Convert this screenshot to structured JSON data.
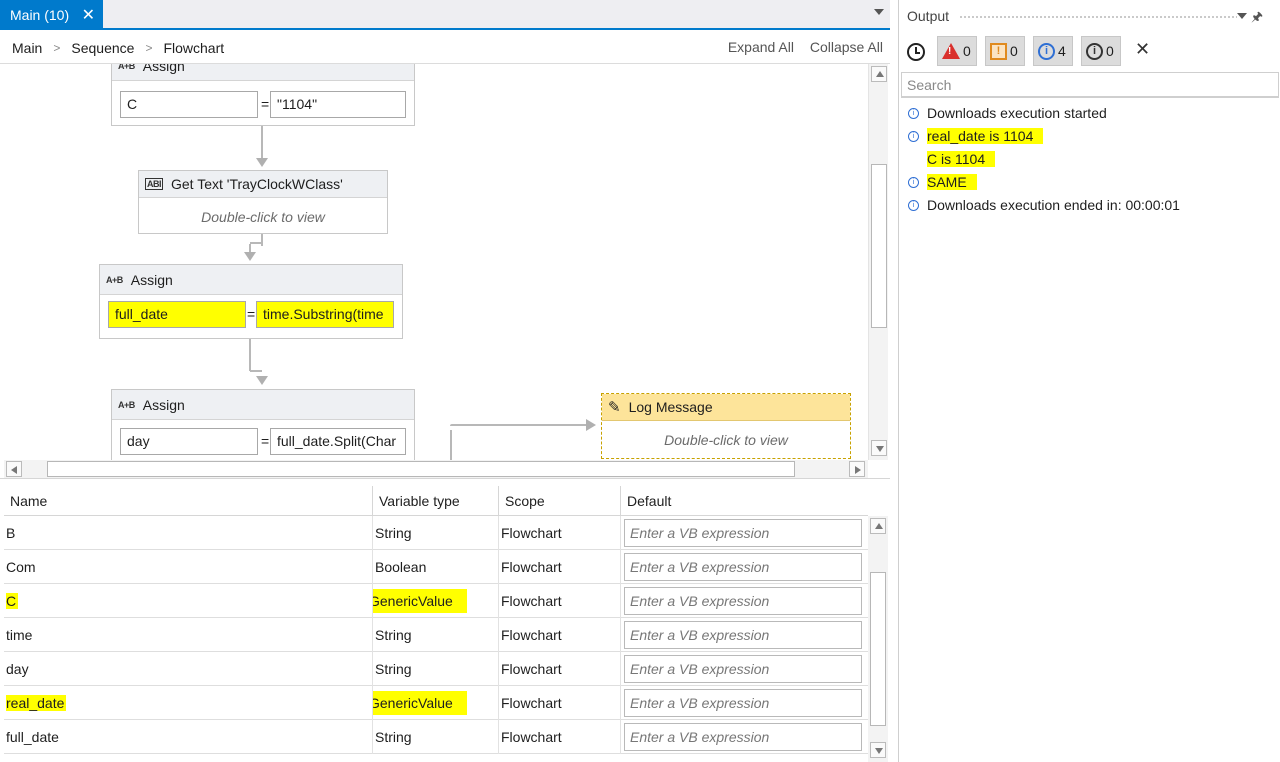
{
  "tab": {
    "label": "Main (10)",
    "close": "✕"
  },
  "breadcrumb": [
    "Main",
    "Sequence",
    "Flowchart"
  ],
  "toolbar": {
    "expand_all": "Expand All",
    "collapse_all": "Collapse All"
  },
  "activities": {
    "assign1": {
      "title": "Assign",
      "icon": "A+B",
      "left": "C",
      "right": "\"1104\""
    },
    "gettext": {
      "title": "Get Text 'TrayClockWClass'",
      "icon": "ABI",
      "body": "Double-click to view"
    },
    "assign2": {
      "title": "Assign",
      "icon": "A+B",
      "left": "full_date",
      "right": "time.Substring(time"
    },
    "assign3": {
      "title": "Assign",
      "icon": "A+B",
      "left": "day",
      "right": "full_date.Split(Char"
    },
    "logmsg": {
      "title": "Log Message",
      "body": "Double-click to view"
    }
  },
  "variables": {
    "headers": [
      "Name",
      "Variable type",
      "Scope",
      "Default"
    ],
    "placeholder": "Enter a VB expression",
    "rows": [
      {
        "name": "B",
        "type": "String",
        "scope": "Flowchart"
      },
      {
        "name": "Com",
        "type": "Boolean",
        "scope": "Flowchart"
      },
      {
        "name": "C",
        "type": "GenericValue",
        "scope": "Flowchart"
      },
      {
        "name": "time",
        "type": "String",
        "scope": "Flowchart"
      },
      {
        "name": "day",
        "type": "String",
        "scope": "Flowchart"
      },
      {
        "name": "real_date",
        "type": "GenericValue",
        "scope": "Flowchart"
      },
      {
        "name": "full_date",
        "type": "String",
        "scope": "Flowchart"
      }
    ]
  },
  "output": {
    "title": "Output",
    "counts": {
      "errors": "0",
      "warnings": "0",
      "info": "4",
      "trace": "0"
    },
    "search_placeholder": "Search",
    "logs": [
      {
        "text": "Downloads execution started",
        "icon": true,
        "highlight": false
      },
      {
        "text": "real_date is 1104",
        "icon": true,
        "highlight": true
      },
      {
        "text": "C is 1104",
        "icon": false,
        "highlight": true
      },
      {
        "text": "SAME",
        "icon": true,
        "highlight": true
      },
      {
        "text": "Downloads execution ended in: 00:00:01",
        "icon": true,
        "highlight": false
      }
    ]
  },
  "colors": {
    "accent": "#007acc",
    "highlight": "#ffff00",
    "log_activity": "#fde49a"
  }
}
